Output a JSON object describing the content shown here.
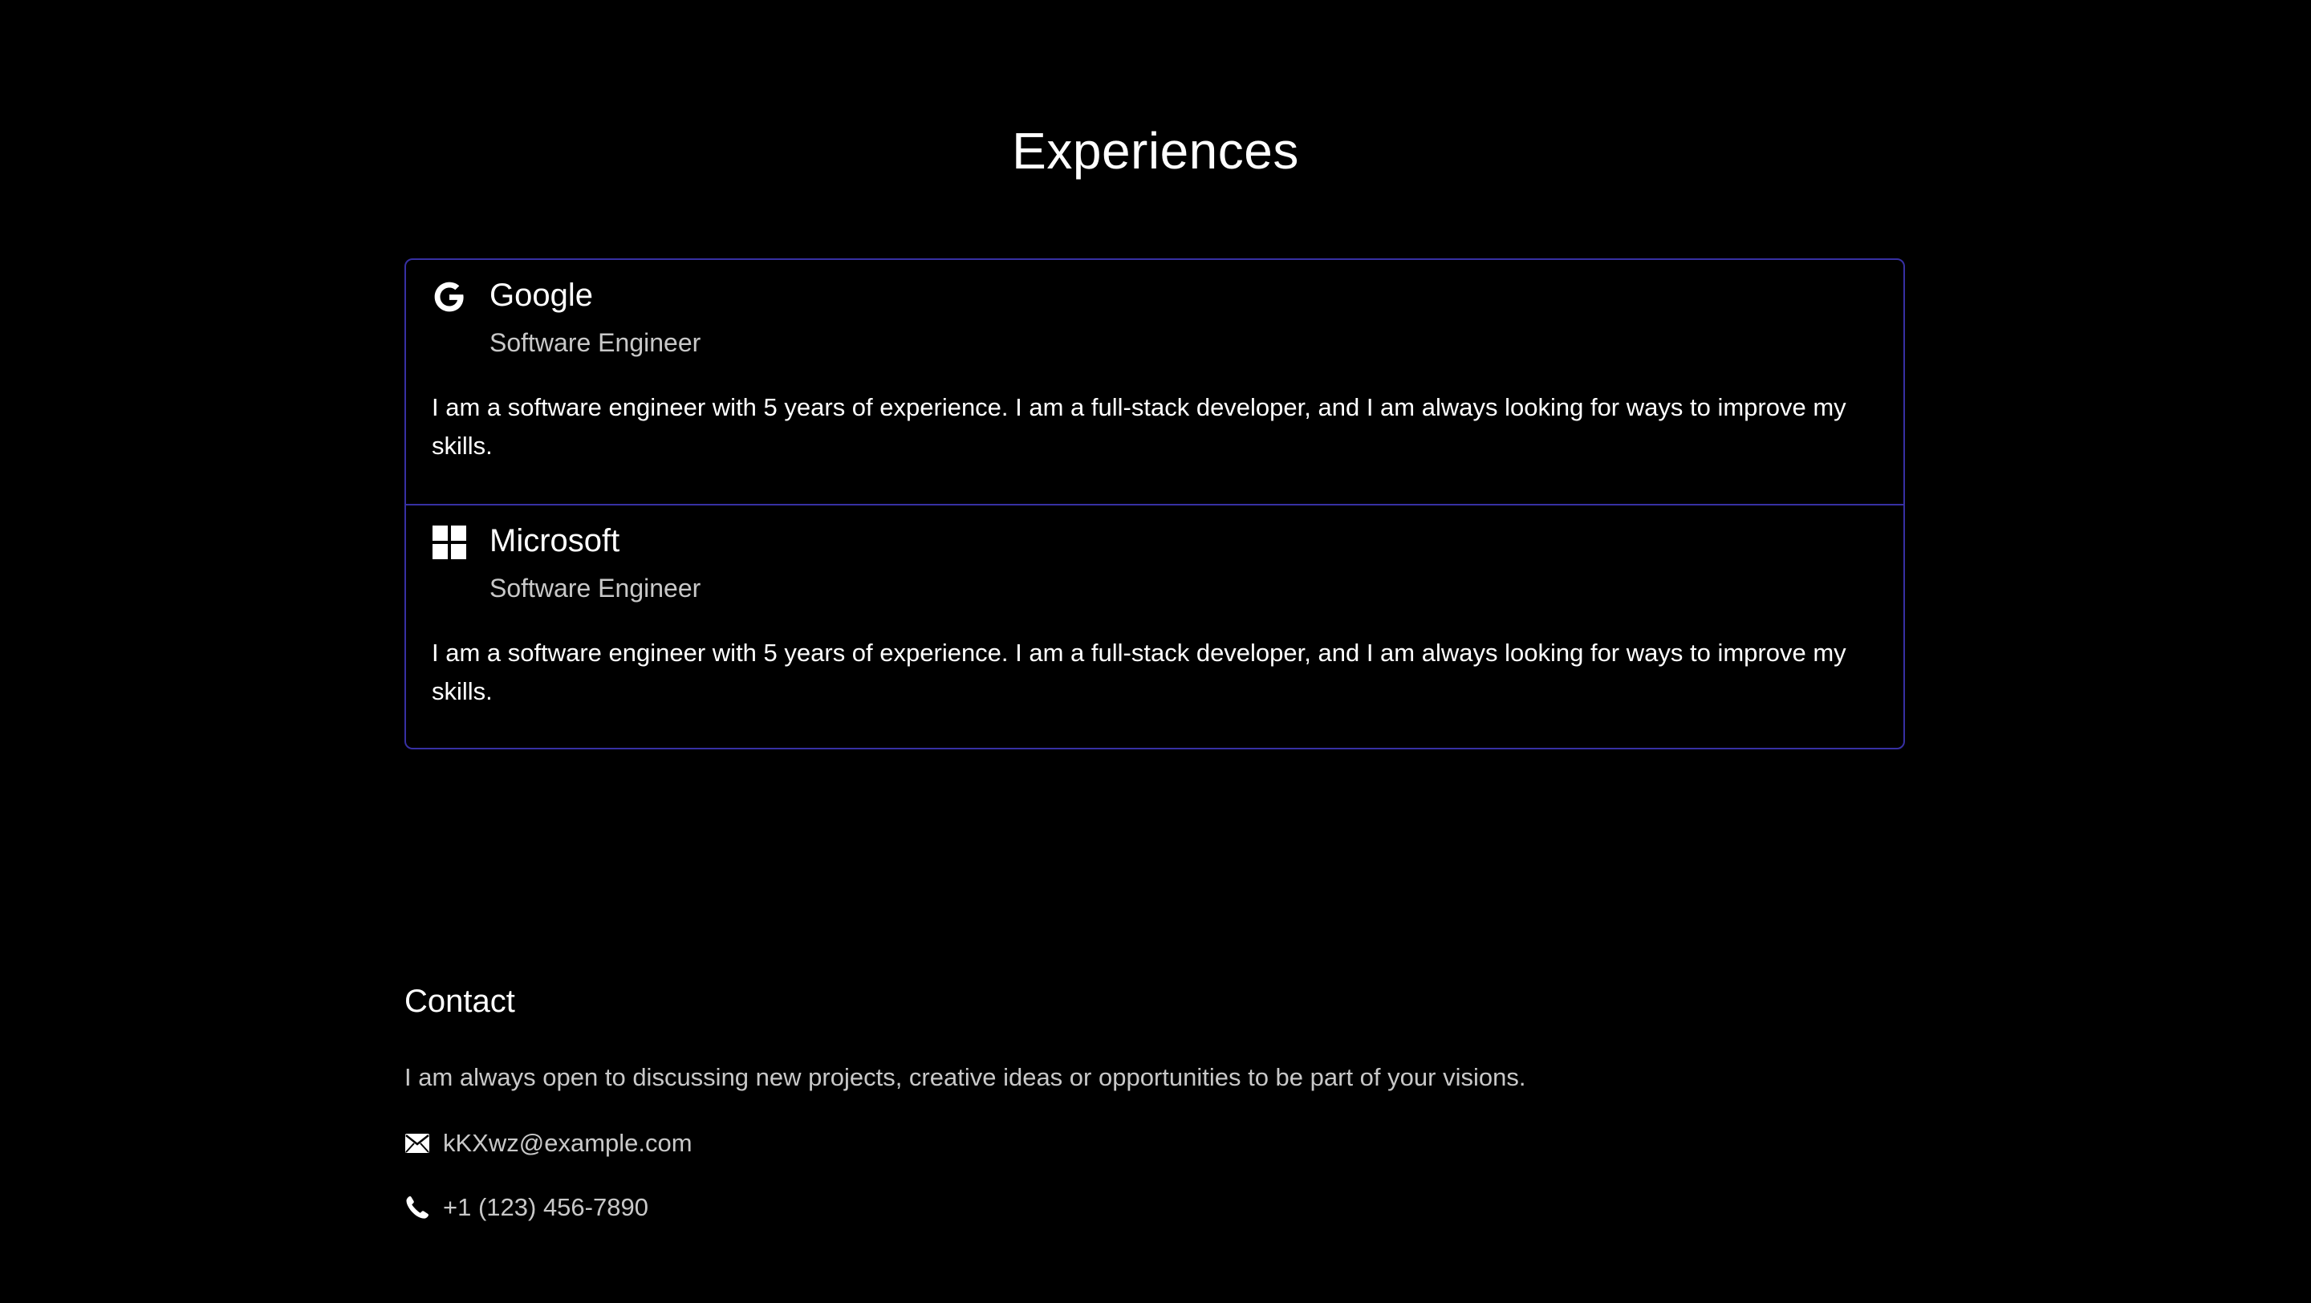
{
  "experiences": {
    "title": "Experiences",
    "items": [
      {
        "company": "Google",
        "role": "Software Engineer",
        "description": "I am a software engineer with 5 years of experience. I am a full-stack developer, and I am always looking for ways to improve my skills.",
        "icon": "google-icon"
      },
      {
        "company": "Microsoft",
        "role": "Software Engineer",
        "description": "I am a software engineer with 5 years of experience. I am a full-stack developer, and I am always looking for ways to improve my skills.",
        "icon": "microsoft-icon"
      }
    ]
  },
  "contact": {
    "title": "Contact",
    "text": "I am always open to discussing new projects, creative ideas or opportunities to be part of your visions.",
    "email": "kKXwz@example.com",
    "phone": "+1 (123) 456-7890"
  },
  "colors": {
    "background": "#000000",
    "card_border": "#3730a3",
    "text_primary": "#ffffff",
    "text_secondary": "#c8c8c8"
  }
}
